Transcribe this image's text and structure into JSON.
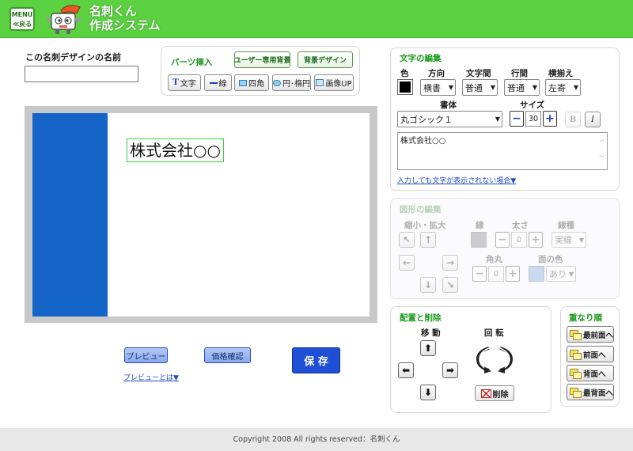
{
  "header": {
    "menu_top": "MENU",
    "menu_bottom": "≪戻る",
    "logo_line1": "名刺くん",
    "logo_line2": "作成システム"
  },
  "name_section": {
    "label": "この名刺デザインの名前",
    "value": ""
  },
  "parts": {
    "title": "パーツ挿入",
    "user_bg": "ユーザー専用背景",
    "bg_design": "背景デザイン",
    "text": "文字",
    "line": "線",
    "rect": "四角",
    "ellipse": "円･楕円",
    "image": "画像UP"
  },
  "card": {
    "text": "株式会社○○",
    "accent_color": "#1565c8"
  },
  "text_edit": {
    "title": "文字の編集",
    "color_label": "色",
    "dir_label": "方向",
    "dir_value": "横書",
    "spacing_label": "文字間",
    "spacing_value": "普通",
    "linesp_label": "行間",
    "linesp_value": "普通",
    "align_label": "横揃え",
    "align_value": "左寄",
    "font_label": "書体",
    "font_value": "丸ゴシック１",
    "size_label": "サイズ",
    "size_value": "30",
    "bold": "B",
    "italic": "I",
    "textarea": "株式会社○○",
    "help_link": "入力しても文字が表示されない場合▼"
  },
  "shape_edit": {
    "title": "図形の編集",
    "scale_label": "縮小・拡大",
    "line_label": "線",
    "thick_label": "太さ",
    "thick_value": "0",
    "ltype_label": "線種",
    "ltype_value": "実線",
    "round_label": "角丸",
    "round_value": "0",
    "fill_label": "面の色",
    "fill_value": "あり"
  },
  "arrange": {
    "title": "配置と削除",
    "move_label": "移 動",
    "rotate_label": "回 転",
    "delete": "削除"
  },
  "layer": {
    "title": "重なり順",
    "front_most": "最前面へ",
    "front": "前面へ",
    "back": "背面へ",
    "back_most": "最背面へ"
  },
  "actions": {
    "preview": "プレビュー",
    "price": "価格確認",
    "save": "保 存",
    "preview_help": "プレビューとは▼"
  },
  "footer": "Copyright 2008 All rights reserved：名刺くん"
}
